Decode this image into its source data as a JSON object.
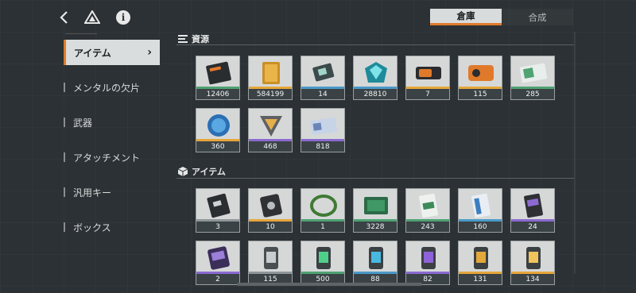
{
  "header": {
    "back_icon": "back-arrow-icon",
    "drive_icon": "triangle-drive-icon",
    "info_icon": "info-icon",
    "info_glyph": "i"
  },
  "tabs": [
    {
      "label": "倉庫",
      "active": true
    },
    {
      "label": "合成",
      "active": false
    }
  ],
  "sidebar": {
    "items": [
      {
        "label": "アイテム",
        "active": true
      },
      {
        "label": "メンタルの欠片",
        "active": false
      },
      {
        "label": "武器",
        "active": false
      },
      {
        "label": "アタッチメント",
        "active": false
      },
      {
        "label": "汎用キー",
        "active": false
      },
      {
        "label": "ボックス",
        "active": false
      }
    ]
  },
  "sections": {
    "resources": {
      "title": "資源",
      "items": [
        {
          "count": "12406",
          "rarity": "green",
          "icon": "ticket-icon"
        },
        {
          "count": "584199",
          "rarity": "gold",
          "icon": "gold-bar-icon"
        },
        {
          "count": "14",
          "rarity": "blue",
          "icon": "chip-icon"
        },
        {
          "count": "28810",
          "rarity": "blue",
          "icon": "crystal-icon"
        },
        {
          "count": "7",
          "rarity": "gold",
          "icon": "orange-card-icon"
        },
        {
          "count": "115",
          "rarity": "gold",
          "icon": "orange-device-icon"
        },
        {
          "count": "285",
          "rarity": "green",
          "icon": "green-card-icon"
        },
        {
          "count": "360",
          "rarity": "gold",
          "icon": "blue-coin-icon"
        },
        {
          "count": "468",
          "rarity": "purple",
          "icon": "badge-icon"
        },
        {
          "count": "818",
          "rarity": "purple",
          "icon": "id-card-icon"
        }
      ]
    },
    "items": {
      "title": "アイテム",
      "items": [
        {
          "count": "3",
          "rarity": "gray",
          "icon": "dark-card-icon"
        },
        {
          "count": "10",
          "rarity": "gold",
          "icon": "dark-pouch-icon"
        },
        {
          "count": "1",
          "rarity": "green",
          "icon": "wreath-icon"
        },
        {
          "count": "3228",
          "rarity": "green",
          "icon": "green-board-icon"
        },
        {
          "count": "243",
          "rarity": "green",
          "icon": "green-keycard-icon"
        },
        {
          "count": "160",
          "rarity": "blue",
          "icon": "blue-keycard-icon"
        },
        {
          "count": "24",
          "rarity": "purple",
          "icon": "purple-keycard-icon"
        },
        {
          "count": "2",
          "rarity": "purple",
          "icon": "purple-pouch-icon"
        },
        {
          "count": "115",
          "rarity": "gray",
          "icon": "gray-canister-icon"
        },
        {
          "count": "500",
          "rarity": "green",
          "icon": "green-canister-icon"
        },
        {
          "count": "88",
          "rarity": "blue",
          "icon": "blue-canister-icon"
        },
        {
          "count": "82",
          "rarity": "purple",
          "icon": "purple-canister-icon"
        },
        {
          "count": "131",
          "rarity": "gold",
          "icon": "gold-canister-icon"
        },
        {
          "count": "134",
          "rarity": "gold",
          "icon": "gold-canister-alt-icon"
        }
      ]
    }
  }
}
